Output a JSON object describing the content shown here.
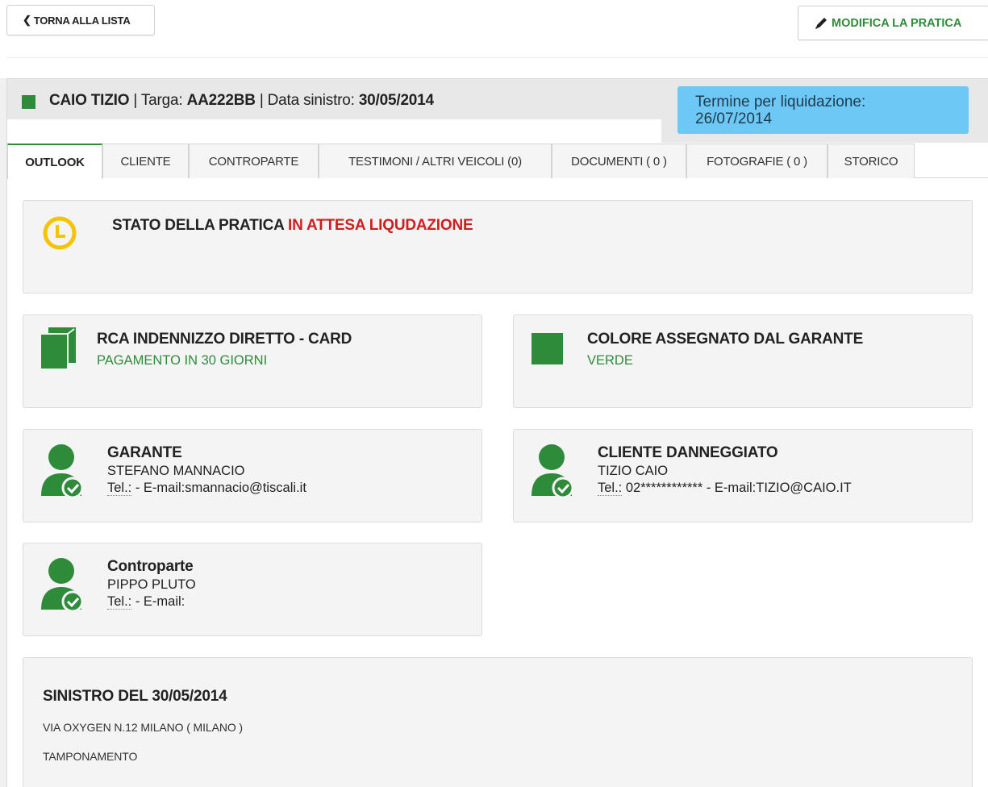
{
  "toolbar": {
    "back_label": "TORNA ALLA LISTA",
    "edit_label": "MODIFICA LA PRATICA"
  },
  "header": {
    "name": "CAIO TIZIO",
    "sep1": " | Targa: ",
    "plate": "AA222BB",
    "sep2": " | Data sinistro: ",
    "date": "30/05/2014",
    "deadline_label": "Termine per liquidazione:",
    "deadline_date": "26/07/2014"
  },
  "tabs": [
    {
      "label": "OUTLOOK"
    },
    {
      "label": "CLIENTE"
    },
    {
      "label": "CONTROPARTE"
    },
    {
      "label": "TESTIMONI / ALTRI VEICOLI (0)"
    },
    {
      "label": "DOCUMENTI ( 0 )"
    },
    {
      "label": "FOTOGRAFIE ( 0 )"
    },
    {
      "label": "STORICO"
    }
  ],
  "status": {
    "label": "STATO DELLA PRATICA",
    "value": "IN ATTESA LIQUDAZIONE"
  },
  "rca": {
    "title": "RCA INDENNIZZO DIRETTO - CARD",
    "subtitle": "PAGAMENTO IN 30 GIORNI"
  },
  "color": {
    "title": "COLORE ASSEGNATO DAL GARANTE",
    "value": "VERDE"
  },
  "garante": {
    "title": "GARANTE",
    "name": "STEFANO MANNACIO",
    "tel_label": "Tel.:",
    "contact": " - E-mail:smannacio@tiscali.it"
  },
  "cliente": {
    "title": "CLIENTE DANNEGGIATO",
    "name": "TIZIO CAIO",
    "tel_label": "Tel.:",
    "contact": " 02************ - E-mail:TIZIO@CAIO.IT"
  },
  "controparte": {
    "title": "Controparte",
    "name": "PIPPO PLUTO",
    "tel_label": "Tel.:",
    "contact": " - E-mail:"
  },
  "sinistro": {
    "title": "SINISTRO DEL 30/05/2014",
    "address": "VIA OXYGEN N.12  MILANO ( MILANO )",
    "type": "TAMPONAMENTO"
  },
  "colors": {
    "accent_green": "#2e8b3a",
    "deadline_blue": "#6dc8f5",
    "status_red": "#cc1f1f",
    "clock_yellow": "#f5c400"
  },
  "icons": {
    "back": "chevron-left-icon",
    "edit": "pencil-icon",
    "status": "clock-icon",
    "rca": "book-icon",
    "color": "square-icon",
    "person": "user-check-icon"
  }
}
